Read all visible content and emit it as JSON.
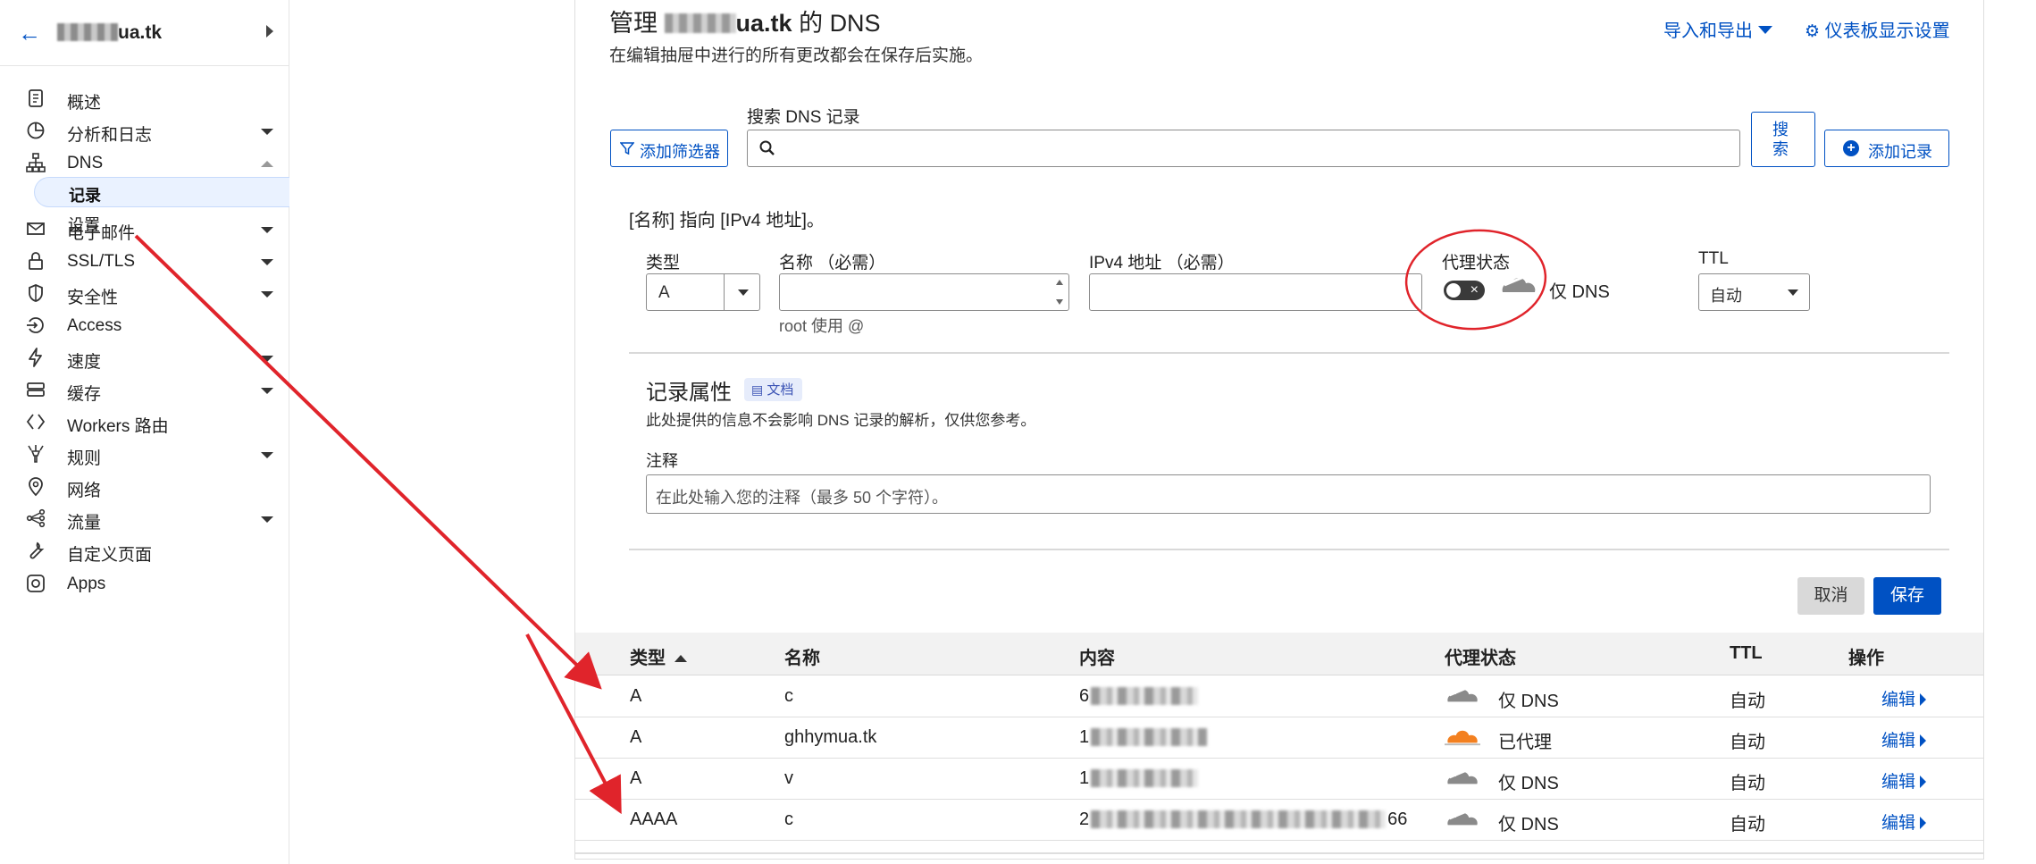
{
  "sidebar": {
    "domain_suffix": "ua.tk",
    "items": [
      {
        "label": "概述",
        "icon": "clipboard-icon",
        "caret": ""
      },
      {
        "label": "分析和日志",
        "icon": "chart-pie-icon",
        "caret": "down"
      },
      {
        "label": "DNS",
        "icon": "dns-sitemap-icon",
        "caret": "up"
      },
      {
        "label": "电子邮件",
        "icon": "mail-icon",
        "caret": "down"
      },
      {
        "label": "SSL/TLS",
        "icon": "lock-icon",
        "caret": "down"
      },
      {
        "label": "安全性",
        "icon": "shield-icon",
        "caret": "down"
      },
      {
        "label": "Access",
        "icon": "access-icon",
        "caret": ""
      },
      {
        "label": "速度",
        "icon": "lightning-icon",
        "caret": "down"
      },
      {
        "label": "缓存",
        "icon": "cache-server-icon",
        "caret": "down"
      },
      {
        "label": "Workers 路由",
        "icon": "workers-icon",
        "caret": ""
      },
      {
        "label": "规则",
        "icon": "rules-icon",
        "caret": "down"
      },
      {
        "label": "网络",
        "icon": "location-pin-icon",
        "caret": ""
      },
      {
        "label": "流量",
        "icon": "traffic-icon",
        "caret": "down"
      },
      {
        "label": "自定义页面",
        "icon": "wrench-icon",
        "caret": ""
      },
      {
        "label": "Apps",
        "icon": "apps-icon",
        "caret": ""
      }
    ],
    "dns_sub": {
      "records": "记录",
      "settings": "设置"
    }
  },
  "header": {
    "title_prefix": "管理",
    "title_domain": "ua.tk",
    "title_suffix": "的 DNS",
    "subtitle": "在编辑抽屉中进行的所有更改都会在保存后实施。",
    "import_export": "导入和导出",
    "dashboard_settings": "仪表板显示设置"
  },
  "toolbar": {
    "add_filter": "添加筛选器",
    "search_label": "搜索 DNS 记录",
    "search_button": "搜索",
    "add_record": "添加记录"
  },
  "form": {
    "description": "[名称] 指向 [IPv4 地址]。",
    "type_label": "类型",
    "type_value": "A",
    "name_label": "名称 （必需）",
    "name_hint": "root 使用 @",
    "ipv4_label": "IPv4 地址 （必需）",
    "proxy_label": "代理状态",
    "proxy_value": "仅 DNS",
    "ttl_label": "TTL",
    "ttl_value": "自动",
    "attributes_title": "记录属性",
    "doc_badge": "文档",
    "attributes_desc": "此处提供的信息不会影响 DNS 记录的解析，仅供您参考。",
    "note_label": "注释",
    "note_placeholder": "在此处输入您的注释（最多 50 个字符）。",
    "cancel": "取消",
    "save": "保存"
  },
  "table": {
    "headers": {
      "type": "类型",
      "name": "名称",
      "content": "内容",
      "proxy": "代理状态",
      "ttl": "TTL",
      "actions": "操作"
    },
    "rows": [
      {
        "type": "A",
        "name": "c",
        "content": "6",
        "proxy": "仅 DNS",
        "proxied": false,
        "ttl": "自动",
        "action": "编辑"
      },
      {
        "type": "A",
        "name": "ghhymua.tk",
        "content": "1",
        "proxy": "已代理",
        "proxied": true,
        "ttl": "自动",
        "action": "编辑"
      },
      {
        "type": "A",
        "name": "v",
        "content": "1",
        "proxy": "仅 DNS",
        "proxied": false,
        "ttl": "自动",
        "action": "编辑"
      },
      {
        "type": "AAAA",
        "name": "c",
        "content": "2",
        "content_end": "66",
        "proxy": "仅 DNS",
        "proxied": false,
        "ttl": "自动",
        "action": "编辑"
      }
    ]
  },
  "colors": {
    "accent": "#0051c3",
    "proxied_cloud": "#f38020",
    "dns_cloud": "#8a8a8a",
    "annotation": "#e0242b"
  }
}
